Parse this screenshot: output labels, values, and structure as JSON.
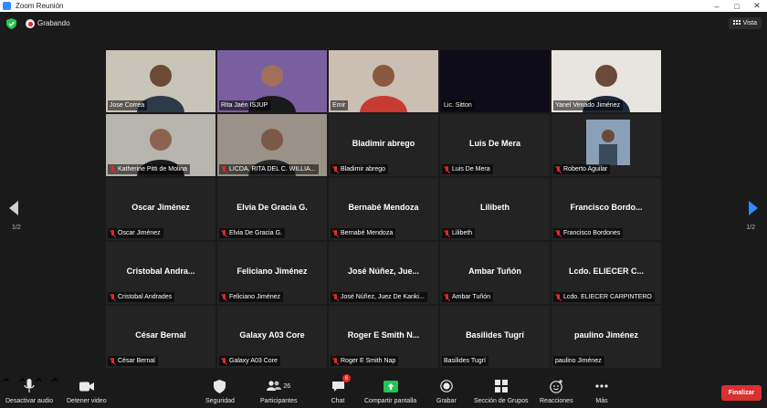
{
  "window": {
    "title": "Zoom Reunión"
  },
  "topbar": {
    "recording_label": "Grabando",
    "view_label": "Vista"
  },
  "pagination": {
    "left": "1/2",
    "right": "1/2"
  },
  "tiles": [
    {
      "name": "Jose Correa",
      "muted": false,
      "video": true,
      "active": true,
      "bg": "#c9c4b8",
      "face": "#6b4a36",
      "shirt": "#2e3a4a"
    },
    {
      "name": "Rita Jaén ISJUP",
      "muted": false,
      "video": true,
      "active": false,
      "bg": "#7a5fa0",
      "face": "#a0705a",
      "shirt": "#1a1a1a"
    },
    {
      "name": "Emir",
      "muted": false,
      "video": true,
      "active": false,
      "bg": "#cbbfb3",
      "face": "#8a5a3e",
      "shirt": "#c83a32"
    },
    {
      "name": "Lic. Sitton",
      "muted": false,
      "video": true,
      "active": false,
      "bg": "#0d0c18",
      "face": "#0d0c18",
      "shirt": "#0d0c18"
    },
    {
      "name": "Yanel Venado Jiménez",
      "muted": false,
      "video": true,
      "active": false,
      "bg": "#e8e4df",
      "face": "#6a4a38",
      "shirt": "#1e2a3a"
    },
    {
      "name": "Katherine Pitti de Molina",
      "muted": true,
      "video": true,
      "active": false,
      "bg": "#b8b4ae",
      "face": "#8a6450",
      "shirt": "#1a1a1a"
    },
    {
      "name": "LICDA. RITA DEL C. WILLIA...",
      "muted": true,
      "video": true,
      "active": false,
      "bg": "#9a9288",
      "face": "#7a5a46",
      "shirt": "#2a2a2a"
    },
    {
      "name": "Bladimir abrego",
      "muted": true,
      "video": false,
      "big": "Bladimir abrego"
    },
    {
      "name": "Luis De Mera",
      "muted": true,
      "video": false,
      "big": "Luis De Mera"
    },
    {
      "name": "Roberto Aguilar",
      "muted": true,
      "video": true,
      "active": false,
      "small_video": true,
      "bg": "#8aa0b8",
      "face": "#6a4a38",
      "shirt": "#3a4a5a"
    },
    {
      "name": "Oscar Jiménez",
      "muted": true,
      "video": false,
      "big": "Oscar Jiménez"
    },
    {
      "name": "Elvia De Gracia G.",
      "muted": true,
      "video": false,
      "big": "Elvia De Gracia G."
    },
    {
      "name": "Bernabé Mendoza",
      "muted": true,
      "video": false,
      "big": "Bernabé Mendoza"
    },
    {
      "name": "Lilibeth",
      "muted": true,
      "video": false,
      "big": "Lilibeth"
    },
    {
      "name": "Francisco Bordones",
      "muted": true,
      "video": false,
      "big": "Francisco Bordo..."
    },
    {
      "name": "Cristobal Andrades",
      "muted": true,
      "video": false,
      "big": "Cristobal Andra..."
    },
    {
      "name": "Feliciano Jiménez",
      "muted": true,
      "video": false,
      "big": "Feliciano Jiménez"
    },
    {
      "name": "José Núñez, Juez De Kanki...",
      "muted": true,
      "video": false,
      "big": "José Núñez, Jue..."
    },
    {
      "name": "Ambar Tuñón",
      "muted": true,
      "video": false,
      "big": "Ambar Tuñón"
    },
    {
      "name": "Lcdo. ELIECER CARPINTERO",
      "muted": true,
      "video": false,
      "big": "Lcdo. ELIECER C..."
    },
    {
      "name": "César Bernal",
      "muted": true,
      "video": false,
      "big": "César Bernal"
    },
    {
      "name": "Galaxy A03 Core",
      "muted": true,
      "video": false,
      "big": "Galaxy A03 Core"
    },
    {
      "name": "Roger E Smith Nap",
      "muted": true,
      "video": false,
      "big": "Roger E Smith N..."
    },
    {
      "name": "Basilides Tugrí",
      "muted": false,
      "video": false,
      "big": "Basilides Tugrí"
    },
    {
      "name": "paulino Jiménez",
      "muted": false,
      "video": false,
      "big": "paulino Jiménez"
    }
  ],
  "toolbar": {
    "mute_label": "Desactivar audio",
    "video_label": "Detener video",
    "security_label": "Seguridad",
    "participants_label": "Participantes",
    "participants_count": "26",
    "chat_label": "Chat",
    "chat_badge": "6",
    "share_label": "Compartir pantalla",
    "record_label": "Grabar",
    "rooms_label": "Sección de Grupos",
    "reactions_label": "Reacciones",
    "more_label": "Más",
    "end_label": "Finalizar"
  },
  "colors": {
    "accent": "#2d8cff",
    "share": "#23c552",
    "end": "#d93030",
    "active_speaker": "#e6d300",
    "muted": "#e02828"
  }
}
